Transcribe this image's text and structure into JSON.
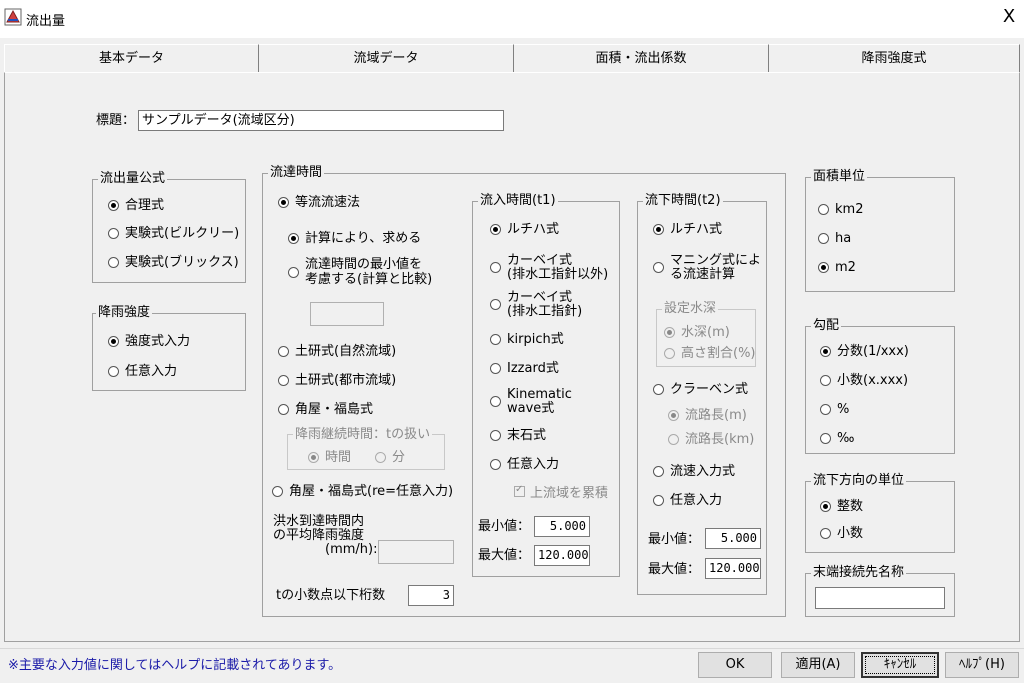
{
  "window": {
    "title": "流出量",
    "close": "X"
  },
  "tabs": [
    "基本データ",
    "流域データ",
    "面積・流出係数",
    "降雨強度式"
  ],
  "title_field": {
    "label": "標題：",
    "value": "サンプルデータ(流域区分)"
  },
  "outflow_formula": {
    "legend": "流出量公式",
    "options": [
      "合理式",
      "実験式(ビルクリー)",
      "実験式(ブリックス)"
    ],
    "selected": 0
  },
  "rain_intensity": {
    "legend": "降雨強度",
    "options": [
      "強度式入力",
      "任意入力"
    ],
    "selected": 0
  },
  "flow_time": {
    "legend": "流達時間",
    "equal_velocity": "等流流速法",
    "calc_opt": "計算により、求める",
    "min_opt": [
      "流達時間の最小値を",
      "考慮する(計算と比較)"
    ],
    "doken_natural": "土研式(自然流域)",
    "doken_urban": "土研式(都市流域)",
    "kadoya": "角屋・福島式",
    "rain_duration": {
      "legend": "降雨継続時間：tの扱い",
      "options": [
        "時間",
        "分"
      ]
    },
    "kadoya_re": "角屋・福島式(re=任意入力)",
    "flood_avg_label": [
      "洪水到達時間内",
      "の平均降雨強度",
      "(mm/h):"
    ],
    "decimal_label": "tの小数点以下桁数",
    "decimal_value": "3"
  },
  "inflow_time": {
    "legend": "流入時間(t1)",
    "options": [
      [
        "ルチハ式"
      ],
      [
        "カーベイ式",
        "(排水工指針以外)"
      ],
      [
        "カーベイ式",
        "(排水工指針)"
      ],
      [
        "kirpich式"
      ],
      [
        "Izzard式"
      ],
      [
        "Kinematic",
        "wave式"
      ],
      [
        "末石式"
      ],
      [
        "任意入力"
      ]
    ],
    "accumulate": "上流域を累積",
    "min_label": "最小値：",
    "min_value": "5.000",
    "max_label": "最大値：",
    "max_value": "120.000"
  },
  "downflow_time": {
    "legend": "流下時間(t2)",
    "rziha": "ルチハ式",
    "manning": [
      "マニング式によ",
      "る流速計算"
    ],
    "water_depth": {
      "legend": "設定水深",
      "options": [
        "水深(m)",
        "高さ割合(%)"
      ]
    },
    "kraven": "クラーベン式",
    "kraven_sub": [
      "流路長(m)",
      "流路長(km)"
    ],
    "velocity_input": "流速入力式",
    "arbitrary": "任意入力",
    "min_label": "最小値：",
    "min_value": "5.000",
    "max_label": "最大値：",
    "max_value": "120.000"
  },
  "area_unit": {
    "legend": "面積単位",
    "options": [
      "km2",
      "ha",
      "m2"
    ],
    "selected": 2
  },
  "slope": {
    "legend": "勾配",
    "options": [
      "分数(1/xxx)",
      "小数(x.xxx)",
      "%",
      "‰"
    ],
    "selected": 0
  },
  "flow_direction": {
    "legend": "流下方向の単位",
    "options": [
      "整数",
      "小数"
    ],
    "selected": 0
  },
  "terminal": {
    "legend": "末端接続先名称",
    "value": ""
  },
  "status": {
    "note": "※主要な入力値に関してはヘルプに記載されてあります。"
  },
  "buttons": {
    "ok": "OK",
    "apply": "適用(A)",
    "cancel": "ｷｬﾝｾﾙ",
    "help": "ﾍﾙﾌﾟ(H)"
  },
  "colors": {
    "note_text": "#1a1aa8",
    "background": "#f0f0f0"
  }
}
